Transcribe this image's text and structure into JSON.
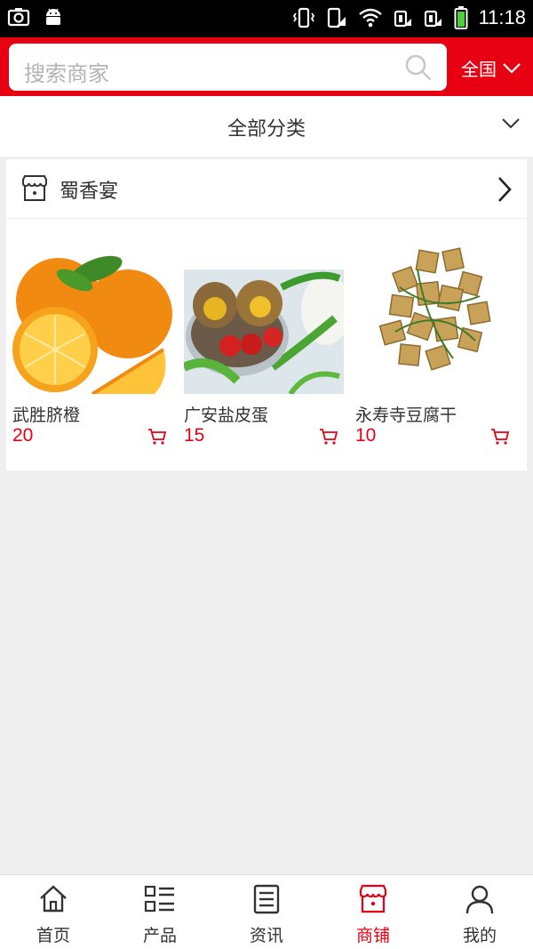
{
  "status_bar": {
    "time": "11:18"
  },
  "search": {
    "placeholder": "搜索商家",
    "region_label": "全国"
  },
  "category": {
    "label": "全部分类"
  },
  "shop": {
    "name": "蜀香宴",
    "products": [
      {
        "name": "武胜脐橙",
        "price": "20"
      },
      {
        "name": "广安盐皮蛋",
        "price": "15"
      },
      {
        "name": "永寿寺豆腐干",
        "price": "10"
      }
    ]
  },
  "tabbar": {
    "items": [
      {
        "label": "首页",
        "icon": "home-icon"
      },
      {
        "label": "产品",
        "icon": "list-icon"
      },
      {
        "label": "资讯",
        "icon": "news-icon"
      },
      {
        "label": "商铺",
        "icon": "shop-icon"
      },
      {
        "label": "我的",
        "icon": "user-icon"
      }
    ],
    "active": "商铺"
  },
  "colors": {
    "brand_red": "#e60012",
    "background": "#efefef"
  }
}
